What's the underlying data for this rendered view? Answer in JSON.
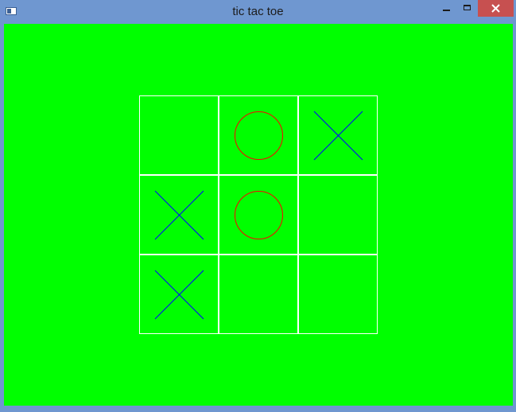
{
  "window": {
    "title": "tic tac toe",
    "icons": {
      "app": "app-icon",
      "minimize": "minimize-icon",
      "maximize": "maximize-icon",
      "close": "close-icon"
    }
  },
  "colors": {
    "background": "#00ff00",
    "grid": "#ffffff",
    "x_mark": "#0000ff",
    "o_mark": "#ff0000",
    "close_button": "#c75050",
    "titlebar": "#6f97d0"
  },
  "board": {
    "rows": [
      [
        "",
        "O",
        "X"
      ],
      [
        "X",
        "O",
        ""
      ],
      [
        "X",
        "",
        ""
      ]
    ]
  }
}
